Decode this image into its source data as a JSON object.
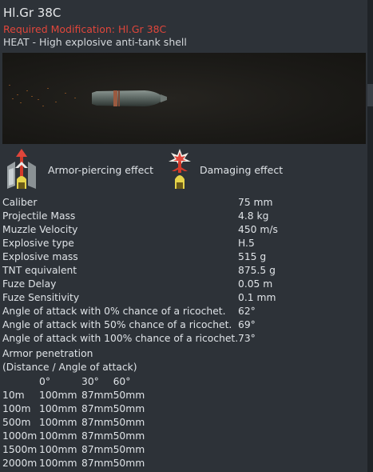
{
  "shell": {
    "title": "Hl.Gr 38C",
    "required_modification": "Required Modification: Hl.Gr 38C",
    "description": "HEAT - High explosive anti-tank shell"
  },
  "effects": {
    "armor_piercing": "Armor-piercing effect",
    "damaging": "Damaging effect"
  },
  "stats": [
    {
      "label": "Caliber",
      "value": "75 mm"
    },
    {
      "label": "Projectile Mass",
      "value": "4.8 kg"
    },
    {
      "label": "Muzzle Velocity",
      "value": "450 m/s"
    },
    {
      "label": "Explosive type",
      "value": "H.5"
    },
    {
      "label": "Explosive mass",
      "value": "515 g"
    },
    {
      "label": "TNT equivalent",
      "value": "875.5 g"
    },
    {
      "label": "Fuze Delay",
      "value": "0.05 m"
    },
    {
      "label": "Fuze Sensitivity",
      "value": "0.1 mm"
    },
    {
      "label": "Angle of attack with 0% chance of a ricochet.",
      "value": "62°"
    },
    {
      "label": "Angle of attack with 50% chance of a ricochet.",
      "value": "69°"
    },
    {
      "label": "Angle of attack with 100% chance of a ricochet.",
      "value": "73°"
    }
  ],
  "penetration": {
    "title": "Armor penetration",
    "subtitle": "(Distance / Angle of attack)",
    "angles": [
      "0°",
      "30°",
      "60°"
    ],
    "rows": [
      {
        "distance": "10m",
        "values": [
          "100mm",
          "87mm",
          "50mm"
        ]
      },
      {
        "distance": "100m",
        "values": [
          "100mm",
          "87mm",
          "50mm"
        ]
      },
      {
        "distance": "500m",
        "values": [
          "100mm",
          "87mm",
          "50mm"
        ]
      },
      {
        "distance": "1000m",
        "values": [
          "100mm",
          "87mm",
          "50mm"
        ]
      },
      {
        "distance": "1500m",
        "values": [
          "100mm",
          "87mm",
          "50mm"
        ]
      },
      {
        "distance": "2000m",
        "values": [
          "100mm",
          "87mm",
          "50mm"
        ]
      }
    ]
  },
  "colors": {
    "background": "#2d3238",
    "required_text": "#e0463b",
    "text": "#dfe3e7"
  }
}
